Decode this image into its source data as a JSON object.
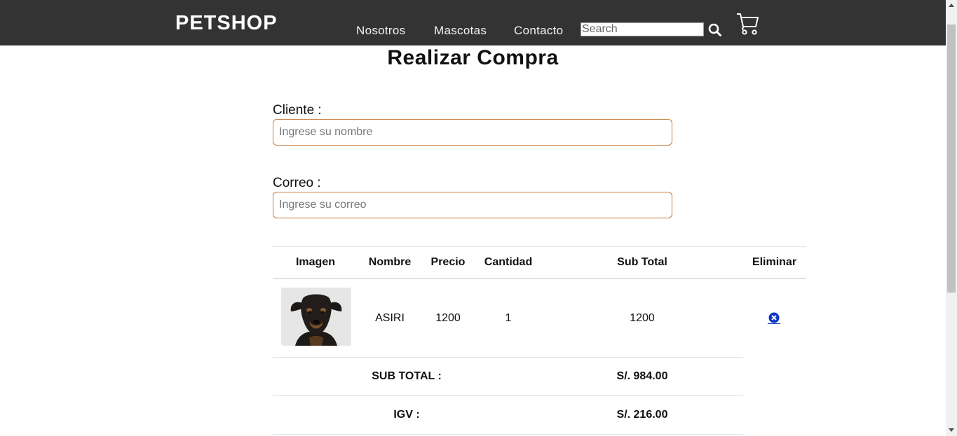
{
  "header": {
    "brand": "PETSHOP",
    "nav": [
      {
        "label": "Nosotros"
      },
      {
        "label": "Mascotas"
      },
      {
        "label": "Contacto"
      }
    ],
    "search_placeholder": "Search",
    "search_icon": "search-icon",
    "cart_icon": "shopping-cart-icon"
  },
  "main": {
    "title": "Realizar Compra",
    "cliente": {
      "label": "Cliente :",
      "placeholder": "Ingrese su nombre"
    },
    "correo": {
      "label": "Correo :",
      "placeholder": "Ingrese su correo"
    }
  },
  "table": {
    "headers": [
      "Imagen",
      "Nombre",
      "Precio",
      "Cantidad",
      "Sub Total",
      "Eliminar"
    ],
    "rows": [
      {
        "image": "dog-photo",
        "nombre": "ASIRI",
        "precio": "1200",
        "cantidad": "1",
        "subtotal": "1200",
        "delete_icon": "remove-circle-icon"
      }
    ],
    "summary": [
      {
        "label": "SUB TOTAL :",
        "value": "S/. 984.00"
      },
      {
        "label": "IGV :",
        "value": "S/. 216.00"
      }
    ]
  },
  "colors": {
    "header_bg": "#333333",
    "input_border": "#c87b3a",
    "delete_icon": "#0b36c4",
    "table_lines": "#dee2e6"
  }
}
